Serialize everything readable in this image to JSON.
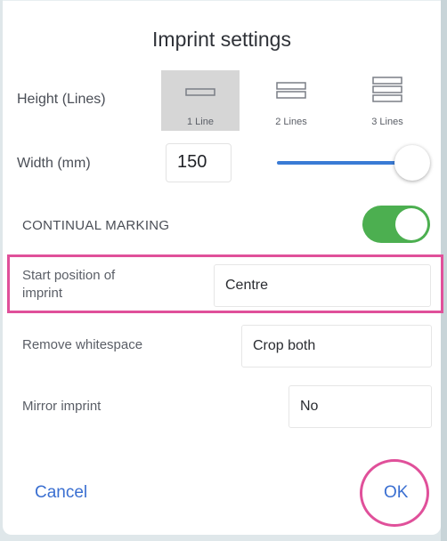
{
  "dialog": {
    "title": "Imprint settings"
  },
  "height": {
    "label": "Height (Lines)",
    "options": [
      {
        "label": "1 Line",
        "selected": true
      },
      {
        "label": "2 Lines",
        "selected": false
      },
      {
        "label": "3 Lines",
        "selected": false
      }
    ]
  },
  "width": {
    "label": "Width (mm)",
    "value": "150",
    "slider_fraction": 1.0
  },
  "continual_marking": {
    "label": "CONTINUAL MARKING",
    "enabled": true
  },
  "start_position": {
    "label": "Start position of imprint",
    "value": "Centre"
  },
  "remove_whitespace": {
    "label": "Remove whitespace",
    "value": "Crop both"
  },
  "mirror_imprint": {
    "label": "Mirror imprint",
    "value": "No"
  },
  "actions": {
    "cancel_label": "Cancel",
    "ok_label": "OK"
  },
  "colors": {
    "accent_blue": "#3a6fd1",
    "toggle_green": "#4caf50",
    "highlight_pink": "#e0509a"
  }
}
